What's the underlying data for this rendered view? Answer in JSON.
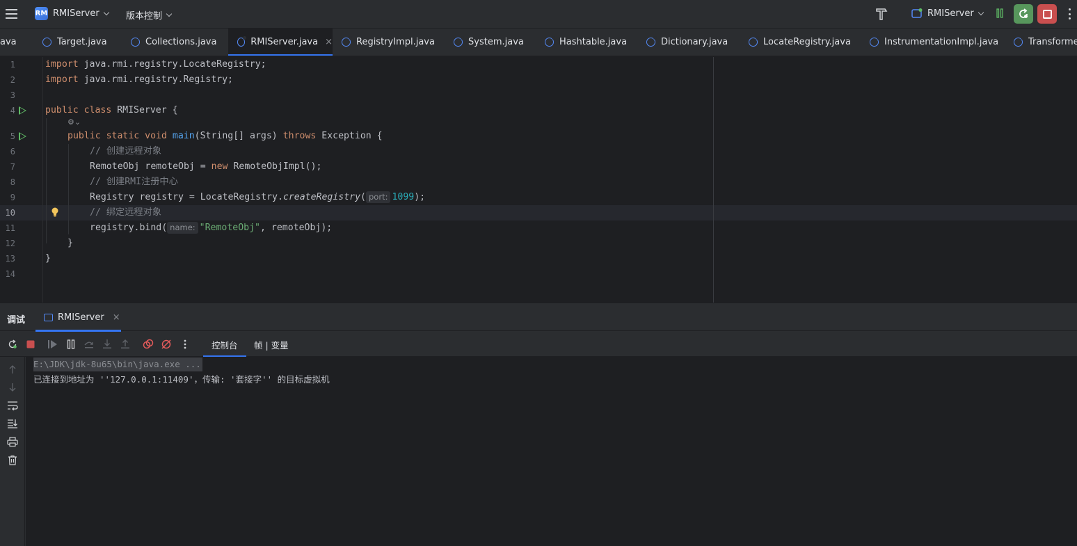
{
  "titlebar": {
    "project_badge": "RM",
    "project_name": "RMIServer",
    "vcs_label": "版本控制",
    "run_config": "RMIServer"
  },
  "tabs": [
    {
      "label": "ava",
      "active": false,
      "icon": "none"
    },
    {
      "label": "Target.java",
      "active": false,
      "icon": "class-icon"
    },
    {
      "label": "Collections.java",
      "active": false,
      "icon": "class-icon"
    },
    {
      "label": "RMIServer.java",
      "active": true,
      "icon": "class-icon"
    },
    {
      "label": "RegistryImpl.java",
      "active": false,
      "icon": "class-icon"
    },
    {
      "label": "System.java",
      "active": false,
      "icon": "class-icon"
    },
    {
      "label": "Hashtable.java",
      "active": false,
      "icon": "class-icon"
    },
    {
      "label": "Dictionary.java",
      "active": false,
      "icon": "class-icon"
    },
    {
      "label": "LocateRegistry.java",
      "active": false,
      "icon": "class-icon"
    },
    {
      "label": "InstrumentationImpl.java",
      "active": false,
      "icon": "class-icon"
    },
    {
      "label": "Transformer",
      "active": false,
      "icon": "class-icon"
    }
  ],
  "tab_close_glyph": "×",
  "editor": {
    "line_numbers": [
      "1",
      "2",
      "3",
      "4",
      "5",
      "6",
      "7",
      "8",
      "9",
      "10",
      "11",
      "12",
      "13",
      "14"
    ],
    "current_line": "10",
    "lens_glyph": "⚙⌄",
    "code": {
      "l1_kw": "import",
      "l1_rest": " java.rmi.registry.LocateRegistry;",
      "l2_kw": "import",
      "l2_rest": " java.rmi.registry.Registry;",
      "l4_kw": "public class",
      "l4_rest": " RMIServer {",
      "l5_kw1": "public static void",
      "l5_fn": "main",
      "l5_mid": "(String[] args) ",
      "l5_kw2": "throws",
      "l5_rest": " Exception {",
      "l6_cmt": "// 创建远程对象",
      "l7_pre": "RemoteObj remoteObj = ",
      "l7_kw": "new",
      "l7_rest": " RemoteObjImpl();",
      "l8_cmt": "// 创建RMI注册中心",
      "l9_pre": "Registry registry = LocateRegistry.",
      "l9_it": "createRegistry",
      "l9_paren": "(",
      "l9_hint": "port:",
      "l9_num": "1099",
      "l9_rest": ");",
      "l10_cmt": "// 绑定远程对象",
      "l11_pre": "registry.bind(",
      "l11_hint": "name:",
      "l11_str": "\"RemoteObj\"",
      "l11_rest": ", remoteObj);",
      "l12": "}",
      "l13": "}"
    }
  },
  "debug": {
    "title": "调试",
    "session_tab": "RMIServer",
    "close_glyph": "×",
    "tool_tabs": [
      "控制台",
      "帧 | 变量"
    ],
    "console": [
      "E:\\JDK\\jdk-8u65\\bin\\java.exe ...",
      "已连接到地址为 ''127.0.0.1:11409'，传输: '套接字'' 的目标虚拟机"
    ]
  },
  "colors": {
    "accent": "#3574f0",
    "run_green": "#57965c",
    "stop_red": "#c94f4f",
    "keyword": "#cf8e6d",
    "function": "#56a8f5",
    "string": "#6aab73",
    "number": "#2aacb8",
    "comment": "#7a7e85"
  }
}
